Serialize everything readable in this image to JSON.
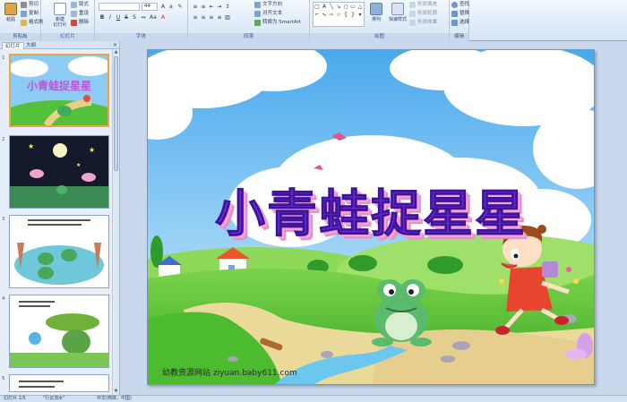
{
  "ribbon": {
    "clipboard": {
      "label": "剪贴板",
      "paste": "粘贴",
      "cut": "剪切",
      "copy": "复制",
      "format_painter": "格式刷"
    },
    "slides": {
      "label": "幻灯片",
      "new_slide": "新建\n幻灯片",
      "layout": "版式",
      "reset": "重设",
      "delete": "删除"
    },
    "font": {
      "label": "字体",
      "font_name": "",
      "font_size": "44"
    },
    "paragraph": {
      "label": "段落",
      "text_direction": "文字方向",
      "align_text": "对齐文本",
      "smartart": "转换为 SmartArt"
    },
    "drawing": {
      "label": "绘图",
      "arrange": "排列",
      "quick_styles": "快速样式",
      "shape_fill": "形状填充",
      "shape_outline": "形状轮廓",
      "shape_effects": "形状效果"
    },
    "editing": {
      "label": "编辑",
      "find": "查找",
      "replace": "替换",
      "select": "选择"
    }
  },
  "pane": {
    "tabs": [
      "幻灯片",
      "大纲"
    ],
    "close": "×",
    "thumbnails": [
      {
        "num": "1",
        "title": "小青蛙捉星星"
      },
      {
        "num": "2"
      },
      {
        "num": "3"
      },
      {
        "num": "4"
      },
      {
        "num": "5"
      }
    ]
  },
  "slide": {
    "title": "小青蛙捉星星",
    "website": "幼教资源网站  ziyuan.baby611.com"
  },
  "status": {
    "slide_count": "幻灯片 1/5",
    "theme": "\"行云流水\"",
    "language": "中文(简体，中国)"
  },
  "colors": {
    "title_fill": "#6b2bd8",
    "title_shadow": "#f4a4d8",
    "sky": "#7ec3f2",
    "grass": "#4cbb2f",
    "selection": "#f0a640"
  }
}
